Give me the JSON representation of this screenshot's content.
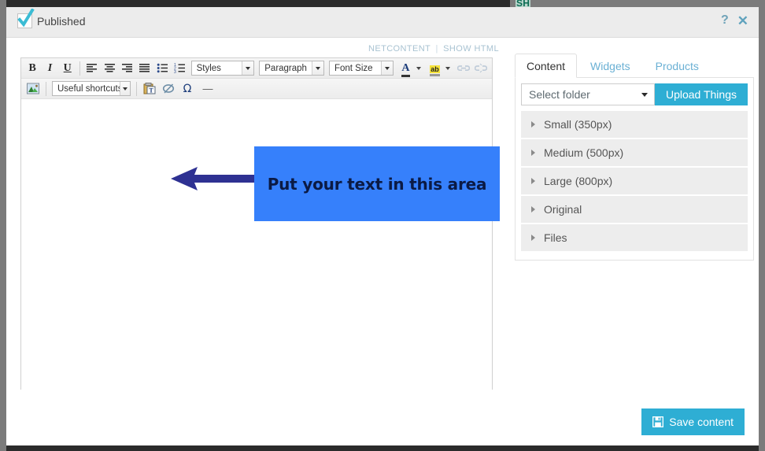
{
  "behind": {
    "fragment_text": "SH"
  },
  "modal": {
    "header": {
      "published_label": "Published",
      "published_checked": true,
      "help_icon": "?",
      "close_icon": "✕"
    },
    "editor": {
      "links": {
        "netcontent": "NETCONTENT",
        "divider": "|",
        "show_html": "SHOW HTML"
      },
      "toolbar_row1": {
        "bold": "B",
        "italic": "I",
        "underline": "U",
        "align_left": "align-left-icon",
        "align_center": "align-center-icon",
        "align_right": "align-right-icon",
        "align_justify": "align-justify-icon",
        "bullet_list": "bullet-list-icon",
        "numbered_list": "numbered-list-icon",
        "styles_label": "Styles",
        "paragraph_label": "Paragraph",
        "fontsize_label": "Font Size",
        "text_color": "A",
        "highlight_color": "ab",
        "link": "link-icon",
        "unlink": "unlink-icon"
      },
      "toolbar_row2": {
        "image": "image-icon",
        "shortcuts_label": "Useful shortcuts",
        "paste_text": "paste-as-text-icon",
        "remove_format": "eraser-icon",
        "special_char": "Ω",
        "horizontal_rule": "—"
      },
      "annotation": {
        "box_text": "Put your text in this area",
        "box_color": "#3680fb",
        "text_color": "#0b1a44",
        "arrow_color": "#2e3192",
        "arrow_direction": "left"
      }
    },
    "right_panel": {
      "tabs": [
        {
          "label": "Content",
          "active": true
        },
        {
          "label": "Widgets",
          "active": false
        },
        {
          "label": "Products",
          "active": false
        }
      ],
      "folder_select_value": "Select folder",
      "upload_button": "Upload Things",
      "accordion": [
        {
          "label": "Small (350px)"
        },
        {
          "label": "Medium (500px)"
        },
        {
          "label": "Large (800px)"
        },
        {
          "label": "Original"
        },
        {
          "label": "Files"
        }
      ]
    },
    "footer": {
      "save_label": "Save content"
    }
  },
  "colors": {
    "accent": "#2eaed4",
    "tab_link": "#6ab0d4",
    "annotation_blue": "#3680fb",
    "annotation_arrow": "#2e3192",
    "header_bg": "#ececec",
    "window_frame": "#7b7b7b"
  }
}
